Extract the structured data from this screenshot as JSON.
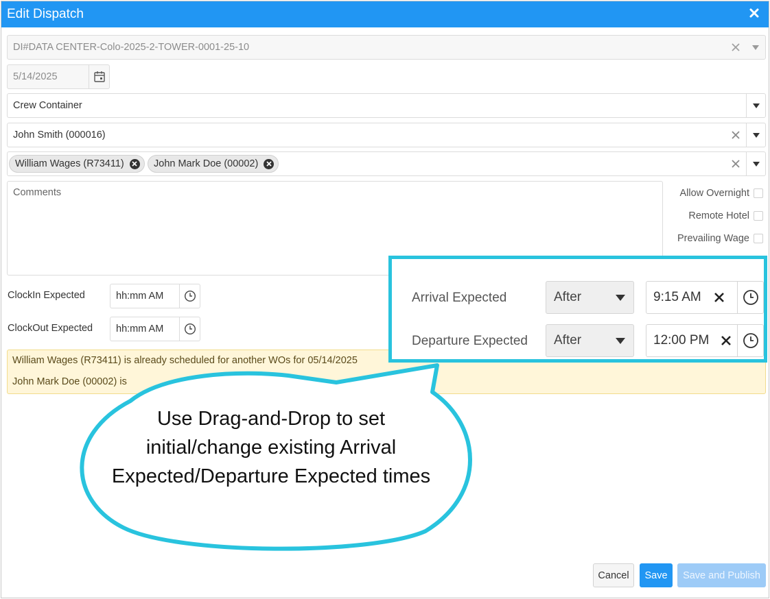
{
  "dialog": {
    "title": "Edit Dispatch"
  },
  "form": {
    "work_order": {
      "value": "DI#DATA CENTER-Colo-2025-2-TOWER-0001-25-10"
    },
    "date": {
      "value": "5/14/2025"
    },
    "container": {
      "value": "Crew Container"
    },
    "supervisor": {
      "value": "John Smith (000016)"
    },
    "crew_tags": [
      {
        "label": "William Wages (R73411)"
      },
      {
        "label": "John Mark Doe (00002)"
      }
    ],
    "comments": {
      "placeholder": "Comments"
    },
    "checkboxes": {
      "allow_overnight": "Allow Overnight",
      "remote_hotel": "Remote Hotel",
      "prevailing_wage": "Prevailing Wage"
    },
    "clockin": {
      "label": "ClockIn Expected",
      "placeholder": "hh:mm AM"
    },
    "clockout": {
      "label": "ClockOut Expected",
      "placeholder": "hh:mm AM"
    }
  },
  "warnings": [
    "William Wages (R73411) is already scheduled for another WOs for 05/14/2025",
    "John Mark Doe (00002) is"
  ],
  "buttons": {
    "cancel": "Cancel",
    "save": "Save",
    "save_publish": "Save and Publish"
  },
  "callout": {
    "arrival": {
      "label": "Arrival Expected",
      "mode": "After",
      "time": "9:15 AM"
    },
    "departure": {
      "label": "Departure Expected",
      "mode": "After",
      "time": "12:00 PM"
    },
    "bubble_text": "Use Drag-and-Drop to set initial/change existing Arrival Expected/Departure Expected times"
  },
  "colors": {
    "title_bar": "#2196f3",
    "callout_border": "#29c3de",
    "warning_bg": "#fff6d9"
  }
}
